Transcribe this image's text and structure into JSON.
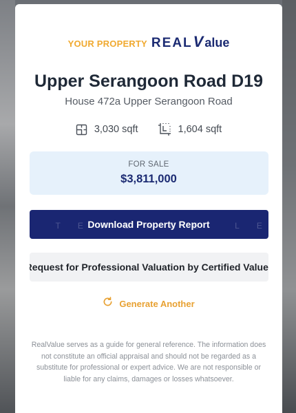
{
  "brand": {
    "prefix": "YOUR PROPERTY",
    "name_real": "REAL",
    "name_v": "V",
    "name_alue": "alue",
    "colors": {
      "prefix": "#f0a92f",
      "name": "#1b2a72"
    }
  },
  "property": {
    "title": "Upper Serangoon Road D19",
    "subtitle": "House 472a Upper Serangoon Road",
    "specs": [
      {
        "icon": "floor-area-icon",
        "value": "3,030 sqft"
      },
      {
        "icon": "land-area-icon",
        "value": "1,604 sqft"
      }
    ]
  },
  "price_box": {
    "label": "FOR SALE",
    "price": "$3,811,000",
    "background": "#e6f1fb"
  },
  "actions": {
    "download_label": "Download Property Report",
    "watermark": "TERENCE LEY",
    "valuation_label": "Request for Professional Valuation by Certified Valuer",
    "regenerate_label": "Generate Another",
    "regenerate_icon": "refresh-icon"
  },
  "disclaimer": "RealValue serves as a guide for general reference. The information does not constitute an official appraisal and should not be regarded as a substitute for professional or expert advice. We are not responsible or liable for any claims, damages or losses whatsoever."
}
